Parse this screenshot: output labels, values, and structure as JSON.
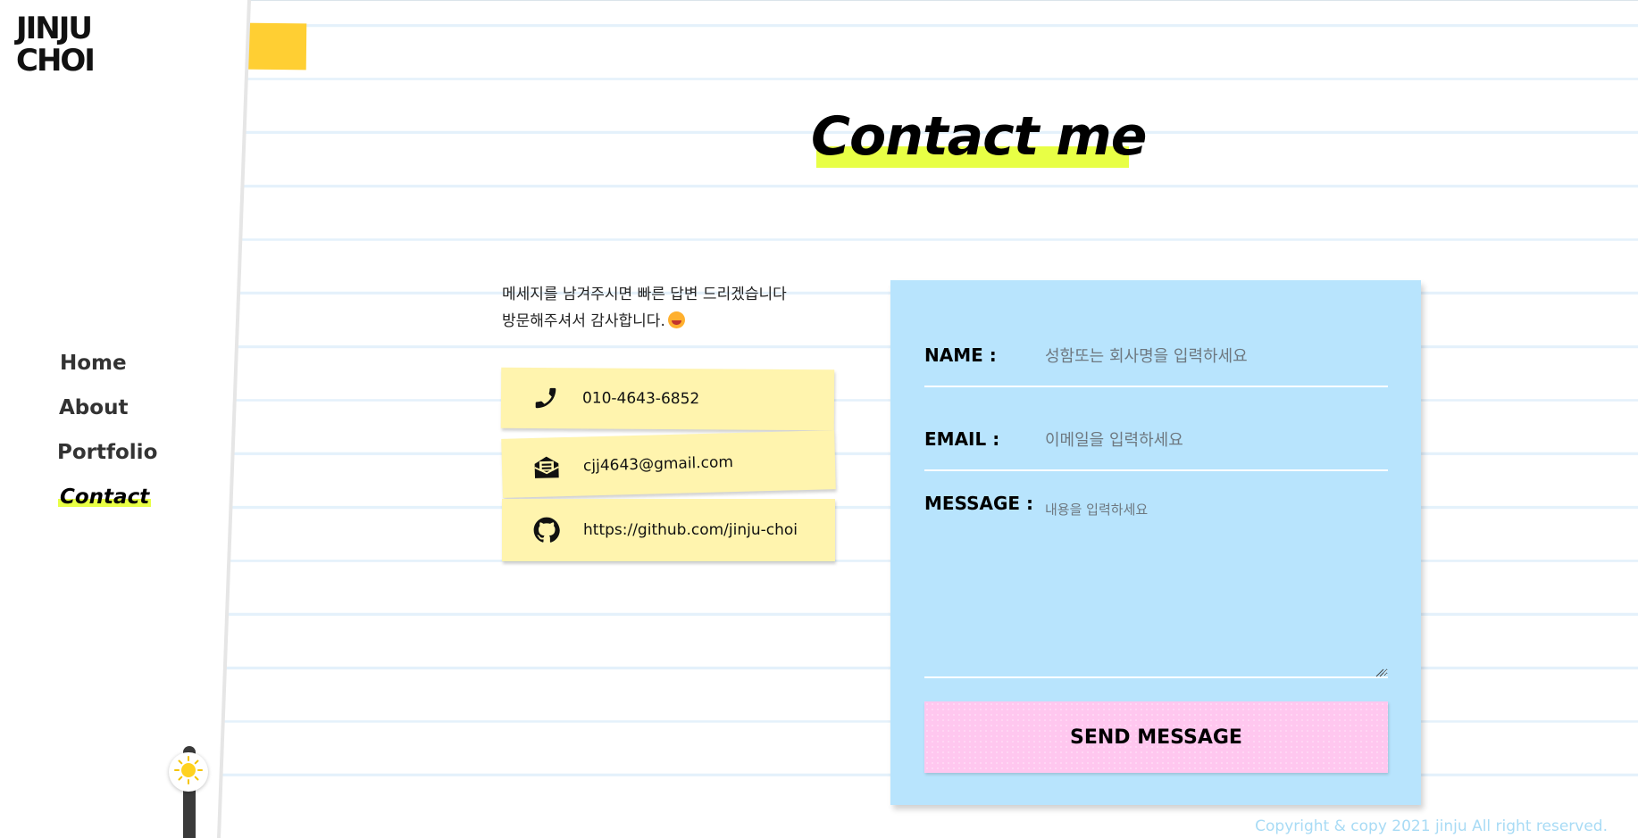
{
  "brand": {
    "logo": "JINJU\nCHOI"
  },
  "nav": {
    "items": [
      {
        "label": "Home"
      },
      {
        "label": "About"
      },
      {
        "label": "Portfolio"
      },
      {
        "label": "Contact",
        "active": true
      }
    ]
  },
  "theme_toggle": {
    "icon": "sun-icon",
    "state": "light"
  },
  "page": {
    "title": "Contact me",
    "intro_line1": "메세지를 남겨주시면 빠른 답변 드리겠습니다",
    "intro_line2": "방문해주셔서 감사합니다."
  },
  "contacts": {
    "phone": {
      "icon": "phone-icon",
      "value": "010-4643-6852"
    },
    "email": {
      "icon": "mail-icon",
      "value": "cjj4643@gmail.com"
    },
    "github": {
      "icon": "github-icon",
      "value": "https://github.com/jinju-choi"
    }
  },
  "form": {
    "name_label": "NAME :",
    "name_placeholder": "성함또는 회사명을 입력하세요",
    "email_label": "EMAIL :",
    "email_placeholder": "이메일을 입력하세요",
    "message_label": "MESSAGE :",
    "message_placeholder": "내용을 입력하세요",
    "submit_label": "SEND MESSAGE"
  },
  "footer": {
    "copyright": "Copyright & copy 2021 jinju All right reserved."
  },
  "colors": {
    "highlight": "#e8ff45",
    "sticky_yellow": "#ffcf33",
    "card_yellow": "#fff4ae",
    "form_blue": "#b8e4fd",
    "button_pink": "#ffc7ef",
    "footer_text": "#a8dbf5"
  }
}
